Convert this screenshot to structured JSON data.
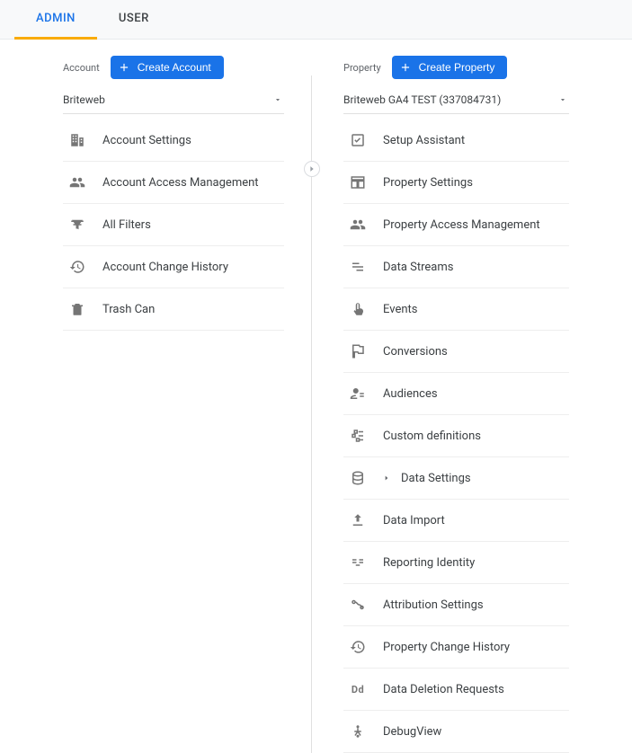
{
  "tabs": {
    "admin": "ADMIN",
    "user": "USER"
  },
  "account": {
    "label": "Account",
    "createBtn": "Create Account",
    "selected": "Briteweb",
    "items": [
      {
        "label": "Account Settings"
      },
      {
        "label": "Account Access Management"
      },
      {
        "label": "All Filters"
      },
      {
        "label": "Account Change History"
      },
      {
        "label": "Trash Can"
      }
    ]
  },
  "property": {
    "label": "Property",
    "createBtn": "Create Property",
    "selected": "Briteweb GA4 TEST (337084731)",
    "items": [
      {
        "label": "Setup Assistant"
      },
      {
        "label": "Property Settings"
      },
      {
        "label": "Property Access Management"
      },
      {
        "label": "Data Streams"
      },
      {
        "label": "Events"
      },
      {
        "label": "Conversions"
      },
      {
        "label": "Audiences"
      },
      {
        "label": "Custom definitions"
      },
      {
        "label": "Data Settings",
        "expandable": true
      },
      {
        "label": "Data Import"
      },
      {
        "label": "Reporting Identity"
      },
      {
        "label": "Attribution Settings"
      },
      {
        "label": "Property Change History"
      },
      {
        "label": "Data Deletion Requests"
      },
      {
        "label": "DebugView"
      }
    ]
  }
}
